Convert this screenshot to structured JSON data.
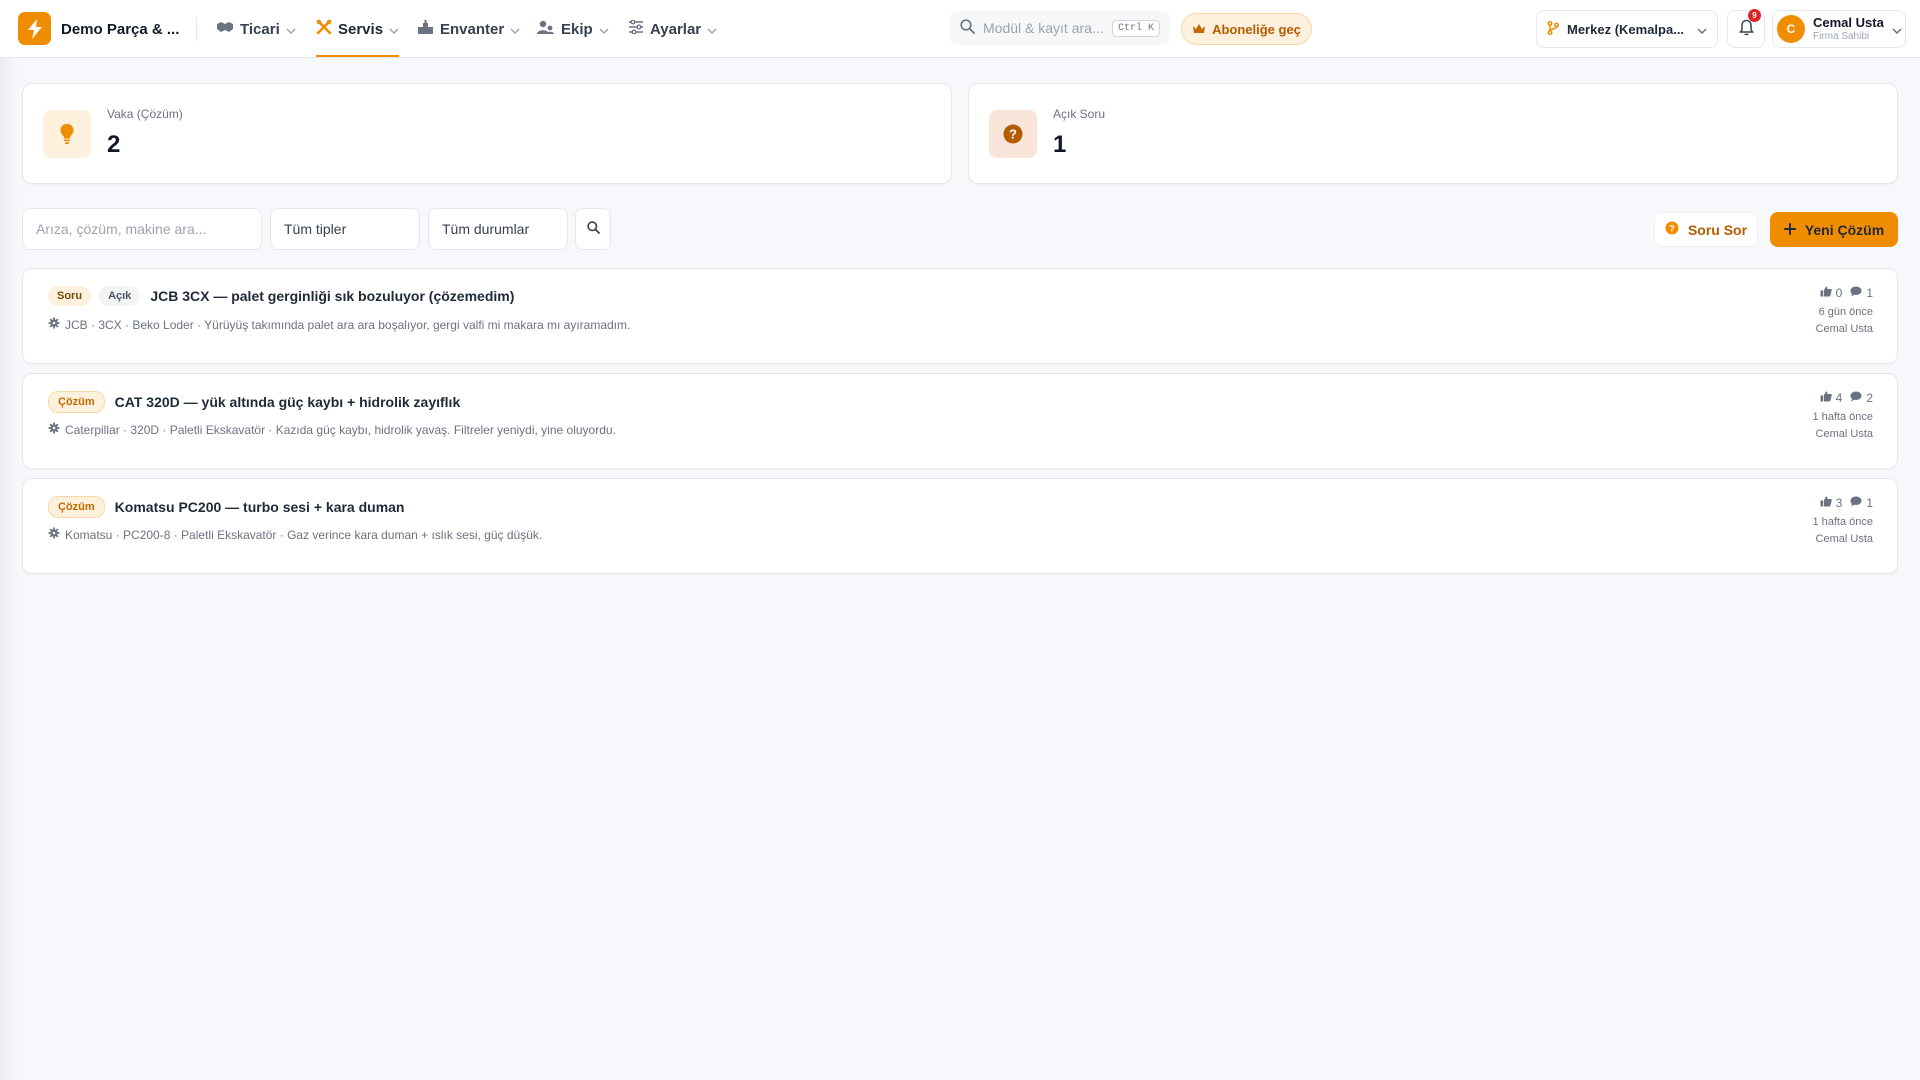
{
  "header": {
    "brand": "Demo Parça & ...",
    "nav": [
      {
        "label": "Ticari",
        "icon": "handshake-icon"
      },
      {
        "label": "Servis",
        "icon": "tools-icon",
        "active": true
      },
      {
        "label": "Envanter",
        "icon": "warehouse-icon"
      },
      {
        "label": "Ekip",
        "icon": "users-icon"
      },
      {
        "label": "Ayarlar",
        "icon": "sliders-icon"
      }
    ],
    "search_placeholder": "Modül & kayıt ara...",
    "search_shortcut": "Ctrl K",
    "upgrade_label": "Aboneliğe geç",
    "branch_label": "Merkez (Kemalpa...",
    "notification_count": "9",
    "user": {
      "initial": "C",
      "name": "Cemal Usta",
      "role": "Firma Sahibi"
    }
  },
  "stats": [
    {
      "label": "Vaka (Çözüm)",
      "value": "2",
      "icon": "lightbulb-icon"
    },
    {
      "label": "Açık Soru",
      "value": "1",
      "icon": "question-circle-icon"
    }
  ],
  "filters": {
    "search_placeholder": "Arıza, çözüm, makine ara...",
    "type_select": "Tüm tipler",
    "status_select": "Tüm durumlar"
  },
  "actions": {
    "ask_label": "Soru Sor",
    "new_label": "Yeni Çözüm"
  },
  "items": [
    {
      "type_tag": "Soru",
      "status_tag": "Açık",
      "title": "JCB 3CX — palet gerginliği sık bozuluyor (çözemedim)",
      "meta": "JCB · 3CX · Beko Loder · Yürüyüş takımında palet ara ara boşalıyor, gergi valfi mi makara mı ayıramadım.",
      "likes": "0",
      "comments": "1",
      "time": "6 gün önce",
      "author": "Cemal Usta"
    },
    {
      "type_tag": "Çözüm",
      "title": "CAT 320D — yük altında güç kaybı + hidrolik zayıflık",
      "meta": "Caterpillar · 320D · Paletli Ekskavatör · Kazıda güç kaybı, hidrolik yavaş. Filtreler yeniydi, yine oluyordu.",
      "likes": "4",
      "comments": "2",
      "time": "1 hafta önce",
      "author": "Cemal Usta"
    },
    {
      "type_tag": "Çözüm",
      "title": "Komatsu PC200 — turbo sesi + kara duman",
      "meta": "Komatsu · PC200-8 · Paletli Ekskavatör · Gaz verince kara duman + ıslık sesi, güç düşük.",
      "likes": "3",
      "comments": "1",
      "time": "1 hafta önce",
      "author": "Cemal Usta"
    }
  ],
  "colors": {
    "accent": "#f08c00",
    "accent_soft": "#fdf1dd",
    "question": "#b35c00"
  }
}
